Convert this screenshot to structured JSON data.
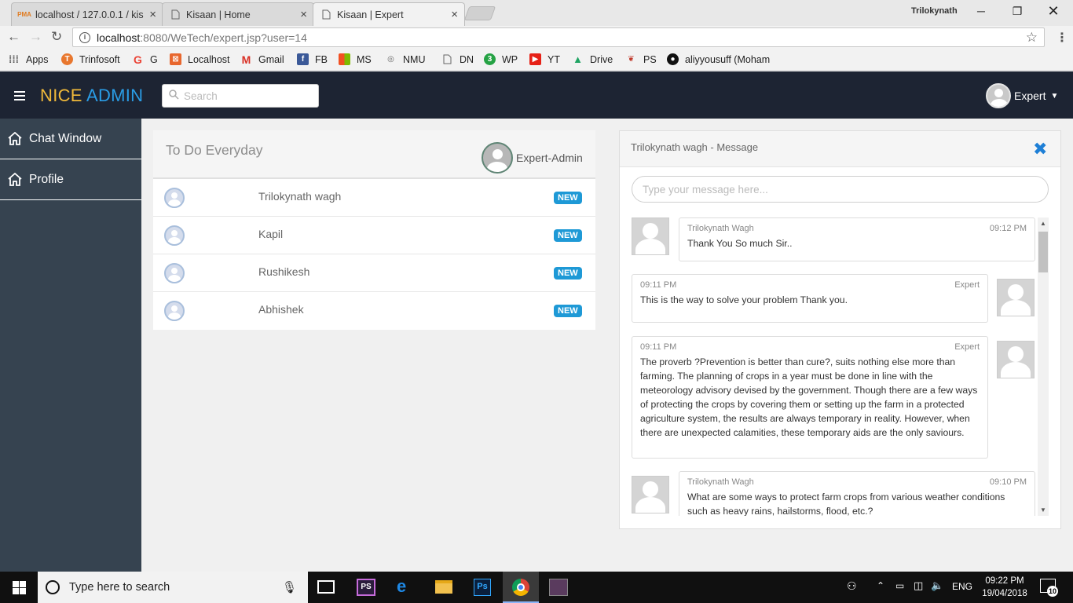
{
  "browser": {
    "tabs": [
      {
        "title": "localhost / 127.0.0.1 / kis",
        "favicon": "pma-icon"
      },
      {
        "title": "Kisaan | Home",
        "favicon": "page-icon"
      },
      {
        "title": "Kisaan | Expert",
        "favicon": "page-icon"
      }
    ],
    "window_user": "Trilokynath",
    "url_host": "localhost",
    "url_path": ":8080/WeTech/expert.jsp?user=14",
    "bookmarks": [
      "Apps",
      "Trinfosoft",
      "G",
      "Localhost",
      "Gmail",
      "FB",
      "MS",
      "NMU",
      "DN",
      "WP",
      "YT",
      "Drive",
      "PS",
      "aliyyousuff (Moham"
    ]
  },
  "header": {
    "brand_nice": "NICE",
    "brand_admin": "ADMIN",
    "search_placeholder": "Search",
    "user": "Expert"
  },
  "sidebar": {
    "items": [
      {
        "label": "Chat Window"
      },
      {
        "label": "Profile"
      }
    ]
  },
  "todo": {
    "title": "To Do Everyday",
    "user": "Expert-Admin",
    "rows": [
      {
        "name": "Trilokynath wagh",
        "badge": "NEW"
      },
      {
        "name": "Kapil",
        "badge": "NEW"
      },
      {
        "name": "Rushikesh",
        "badge": "NEW"
      },
      {
        "name": "Abhishek",
        "badge": "NEW"
      }
    ]
  },
  "messages": {
    "title": "Trilokynath wagh - Message",
    "input_placeholder": "Type your message here...",
    "items": [
      {
        "sender": "Trilokynath Wagh",
        "time": "09:12 PM",
        "text": "Thank You So much Sir.."
      },
      {
        "sender": "Expert",
        "time": "09:11 PM",
        "text": "This is the way to solve your problem Thank you."
      },
      {
        "sender": "Expert",
        "time": "09:11 PM",
        "text": "The proverb ?Prevention is better than cure?, suits nothing else more than farming. The planning of crops in a year must be done in line with the meteorology advisory devised by the government. Though there are a few ways of protecting the crops by covering them or setting up the farm in a protected agriculture system, the results are always temporary in reality. However, when there are unexpected calamities, these temporary aids are the only saviours."
      },
      {
        "sender": "Trilokynath Wagh",
        "time": "09:10 PM",
        "text": "What are some ways to protect farm crops from various weather conditions such as heavy rains, hailstorms, flood, etc.?"
      }
    ]
  },
  "taskbar": {
    "search_placeholder": "Type here to search",
    "language": "ENG",
    "time": "09:22 PM",
    "date": "19/04/2018",
    "notifications": "10"
  },
  "colors": {
    "header_bg": "#1d2433",
    "sidebar_bg": "#364350",
    "brand_nice": "#f0b93a",
    "brand_admin": "#2a9de6",
    "badge": "#1e99d6"
  }
}
